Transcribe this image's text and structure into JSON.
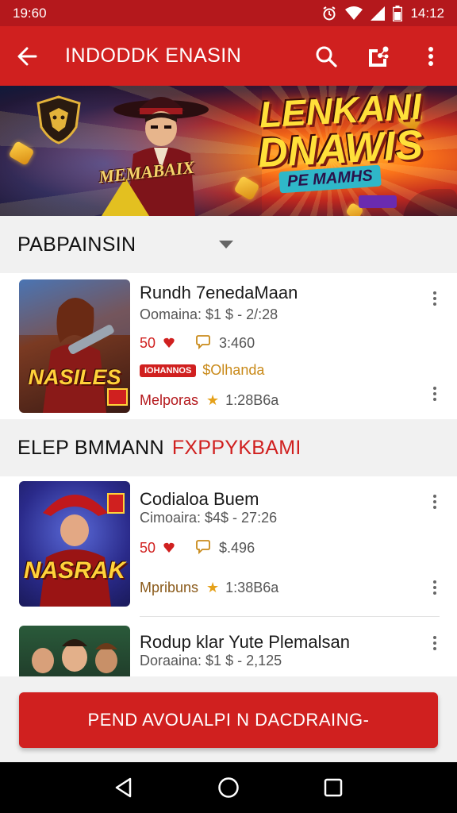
{
  "status_bar": {
    "time": "19:60",
    "clock_right": "14:12",
    "icons": [
      "alarm-icon",
      "wifi-icon",
      "signal-icon",
      "battery-icon"
    ]
  },
  "app_bar": {
    "title": "INDODDK ENASIN",
    "icons": [
      "back-arrow-icon",
      "search-icon",
      "share-icon",
      "more-vert-icon"
    ]
  },
  "banner": {
    "plaque": "MEMABAIX",
    "headline_line1": "LENKANI",
    "headline_line2": "DNAWIS",
    "subline": "PE MAMHS"
  },
  "sections": [
    {
      "title": "PABPAINSIN",
      "accent": ""
    },
    {
      "title": "ELEP BMMANN",
      "accent": "FXPPYKBAMI"
    }
  ],
  "games": [
    {
      "thumb_label": "NASILES",
      "title": "Rundh 7enedaMaan",
      "meta": "Oomaina: $1 $ - 2/:28",
      "rating": "50",
      "comments": "3:460",
      "badge": "IOHANNOS",
      "badge_text": "$Olhanda",
      "publisher": "Melporas",
      "score": "1:28B6a"
    },
    {
      "thumb_label": "NASRAK",
      "title": "Codialoa Buem",
      "meta": "Cimoaira: $4$ - 27:26",
      "rating": "50",
      "comments": "$.496",
      "publisher": "Mpribuns",
      "score": "1:38B6a"
    },
    {
      "title": "Rodup klar Yute Plemalsan",
      "meta": "Doraaina: $1 $ - 2,125"
    }
  ],
  "cta": {
    "label": "PEND AVOUALPI N DACDRAING-"
  },
  "nav_bar": {
    "icons": [
      "back-triangle-icon",
      "home-circle-icon",
      "recents-square-icon"
    ]
  },
  "colors": {
    "primary": "#d0201f",
    "status": "#b4181c",
    "star": "#e5a11a",
    "background": "#f1f1f1"
  }
}
